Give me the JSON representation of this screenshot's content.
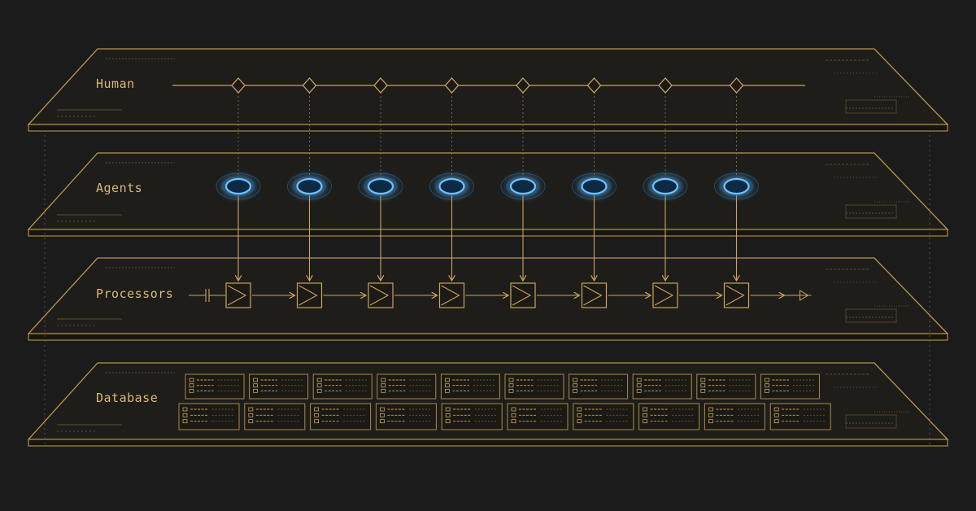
{
  "colors": {
    "background": "#1b1b1b",
    "layer_stroke": "#b8964f",
    "layer_fill": "#1e1d1a",
    "label": "#d9b877",
    "connector": "#c9a560",
    "dotted": "#7d6942",
    "detail": "#6f5c36",
    "agent_glow": "#2a9bff",
    "agent_core": "#6fc3ff"
  },
  "layers": [
    {
      "id": "human",
      "label": "Human",
      "node_shape": "diamond"
    },
    {
      "id": "agents",
      "label": "Agents",
      "node_shape": "glowing-ellipse"
    },
    {
      "id": "processors",
      "label": "Processors",
      "node_shape": "chevron-box"
    },
    {
      "id": "database",
      "label": "Database",
      "node_shape": "table-grid"
    }
  ],
  "pipeline_count": 8,
  "database_tables": {
    "rows": 2,
    "columns": 10
  }
}
